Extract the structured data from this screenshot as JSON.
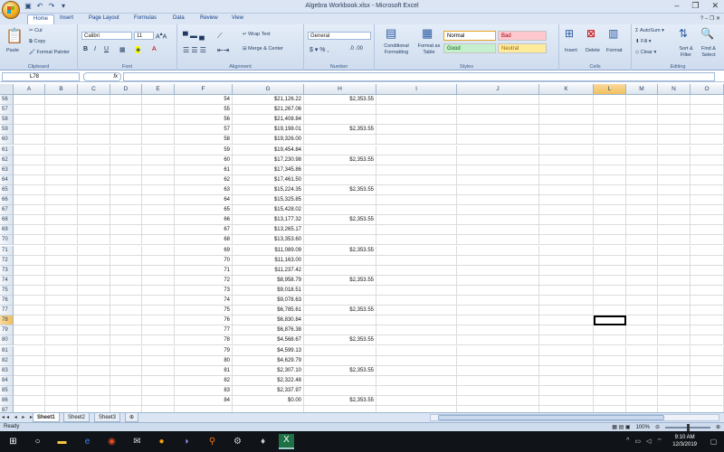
{
  "window": {
    "title": "Algebra Workbook.xlsx - Microsoft Excel",
    "controls": [
      "–",
      "❐",
      "✕"
    ]
  },
  "tabs": [
    "Home",
    "Insert",
    "Page Layout",
    "Formulas",
    "Data",
    "Review",
    "View"
  ],
  "ribbon": {
    "clipboard": {
      "label": "Clipboard",
      "paste": "Paste",
      "cut": "Cut",
      "copy": "Copy",
      "format_painter": "Format Painter"
    },
    "font": {
      "label": "Font",
      "name": "Calibri",
      "size": "11"
    },
    "alignment": {
      "label": "Alignment",
      "wrap": "Wrap Text",
      "merge": "Merge & Center"
    },
    "number": {
      "label": "Number",
      "format": "General"
    },
    "styles": {
      "label": "Styles",
      "conditional": "Conditional Formatting",
      "format_table": "Format as Table",
      "normal": "Normal",
      "bad": "Bad",
      "good": "Good",
      "neutral": "Neutral"
    },
    "cells": {
      "label": "Cells",
      "insert": "Insert",
      "delete": "Delete",
      "format": "Format"
    },
    "editing": {
      "label": "Editing",
      "autosum": "AutoSum",
      "fill": "Fill",
      "clear": "Clear",
      "sort": "Sort & Filter",
      "find": "Find & Select"
    }
  },
  "formula_bar": {
    "name_box": "L78",
    "fx": "fx",
    "content": ""
  },
  "columns": [
    "A",
    "B",
    "C",
    "D",
    "E",
    "F",
    "G",
    "H",
    "I",
    "J",
    "K",
    "L",
    "M",
    "N",
    "O"
  ],
  "selected_column": "L",
  "selected_row": "78",
  "rows": [
    {
      "n": "56",
      "f": "54",
      "g": "$21,126.22",
      "h": "$2,353.55"
    },
    {
      "n": "57",
      "f": "55",
      "g": "$21,267.06",
      "h": ""
    },
    {
      "n": "58",
      "f": "56",
      "g": "$21,408.84",
      "h": ""
    },
    {
      "n": "59",
      "f": "57",
      "g": "$19,198.01",
      "h": "$2,353.55"
    },
    {
      "n": "60",
      "f": "58",
      "g": "$19,326.00",
      "h": ""
    },
    {
      "n": "61",
      "f": "59",
      "g": "$19,454.84",
      "h": ""
    },
    {
      "n": "62",
      "f": "60",
      "g": "$17,230.98",
      "h": "$2,353.55"
    },
    {
      "n": "63",
      "f": "61",
      "g": "$17,345.86",
      "h": ""
    },
    {
      "n": "64",
      "f": "62",
      "g": "$17,461.50",
      "h": ""
    },
    {
      "n": "65",
      "f": "63",
      "g": "$15,224.35",
      "h": "$2,353.55"
    },
    {
      "n": "66",
      "f": "64",
      "g": "$15,325.85",
      "h": ""
    },
    {
      "n": "67",
      "f": "65",
      "g": "$15,428.02",
      "h": ""
    },
    {
      "n": "68",
      "f": "66",
      "g": "$13,177.32",
      "h": "$2,353.55"
    },
    {
      "n": "69",
      "f": "67",
      "g": "$13,265.17",
      "h": ""
    },
    {
      "n": "70",
      "f": "68",
      "g": "$13,353.60",
      "h": ""
    },
    {
      "n": "71",
      "f": "69",
      "g": "$11,089.09",
      "h": "$2,353.55"
    },
    {
      "n": "72",
      "f": "70",
      "g": "$11,163.00",
      "h": ""
    },
    {
      "n": "73",
      "f": "71",
      "g": "$11,237.42",
      "h": ""
    },
    {
      "n": "74",
      "f": "72",
      "g": "$8,958.79",
      "h": "$2,353.55"
    },
    {
      "n": "75",
      "f": "73",
      "g": "$9,018.51",
      "h": ""
    },
    {
      "n": "76",
      "f": "74",
      "g": "$9,078.63",
      "h": ""
    },
    {
      "n": "77",
      "f": "75",
      "g": "$6,785.61",
      "h": "$2,353.55"
    },
    {
      "n": "78",
      "f": "76",
      "g": "$6,830.84",
      "h": ""
    },
    {
      "n": "79",
      "f": "77",
      "g": "$6,876.38",
      "h": ""
    },
    {
      "n": "80",
      "f": "78",
      "g": "$4,568.67",
      "h": "$2,353.55"
    },
    {
      "n": "81",
      "f": "79",
      "g": "$4,599.13",
      "h": ""
    },
    {
      "n": "82",
      "f": "80",
      "g": "$4,629.79",
      "h": ""
    },
    {
      "n": "83",
      "f": "81",
      "g": "$2,307.10",
      "h": "$2,353.55"
    },
    {
      "n": "84",
      "f": "82",
      "g": "$2,322.48",
      "h": ""
    },
    {
      "n": "85",
      "f": "83",
      "g": "$2,337.97",
      "h": ""
    },
    {
      "n": "86",
      "f": "84",
      "g": "$0.00",
      "h": "$2,353.55"
    },
    {
      "n": "87",
      "f": "",
      "g": "",
      "h": ""
    }
  ],
  "sheets": [
    "Sheet1",
    "Sheet2",
    "Sheet3"
  ],
  "active_sheet": "Sheet1",
  "status": {
    "text": "Ready",
    "zoom": "100%"
  },
  "taskbar": {
    "time": "9:10 AM",
    "date": "12/3/2019"
  },
  "colors": {
    "accent": "#f1c05b",
    "ribbon_blue": "#15428b",
    "taskbar": "#101418",
    "excel_green": "#1e7145"
  }
}
